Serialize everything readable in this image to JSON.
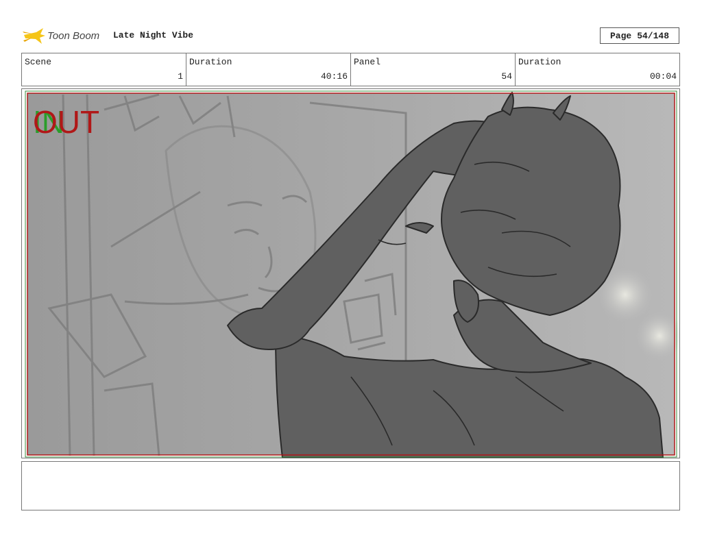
{
  "header": {
    "logo_text": "Toon Boom",
    "project_title": "Late Night Vibe",
    "page_label": "Page",
    "page_value": "54/148"
  },
  "info": {
    "scene_label": "Scene",
    "scene_value": "1",
    "duration_label": "Duration",
    "duration_value": "40:16",
    "panel_label": "Panel",
    "panel_value": "54",
    "panel_duration_label": "Duration",
    "panel_duration_value": "00:04"
  },
  "panel": {
    "in_marker": "IN",
    "out_marker": "OUT",
    "in_color": "#2a9d2a",
    "out_color": "#b01818"
  },
  "notes": {
    "text": ""
  }
}
